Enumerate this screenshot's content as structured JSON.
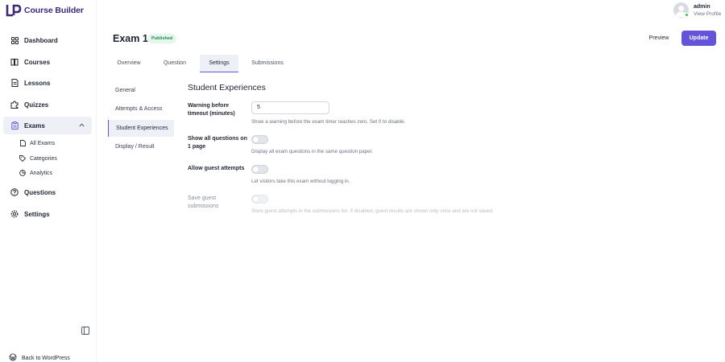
{
  "app": {
    "logo_text": "Course Builder"
  },
  "sidebar": {
    "items": [
      {
        "label": "Dashboard",
        "icon": "grid-icon"
      },
      {
        "label": "Courses",
        "icon": "book-icon"
      },
      {
        "label": "Lessons",
        "icon": "document-icon"
      },
      {
        "label": "Quizzes",
        "icon": "puzzle-icon"
      },
      {
        "label": "Exams",
        "icon": "clipboard-icon"
      },
      {
        "label": "Questions",
        "icon": "question-icon"
      },
      {
        "label": "Settings",
        "icon": "gear-icon"
      }
    ],
    "exams_sub": [
      {
        "label": "All Exams",
        "icon": "file-icon"
      },
      {
        "label": "Categories",
        "icon": "tags-icon"
      },
      {
        "label": "Analytics",
        "icon": "pie-icon"
      }
    ],
    "back_label": "Back to WordPress"
  },
  "profile": {
    "name": "admin",
    "link": "View Profile"
  },
  "header": {
    "title": "Exam 1",
    "status": "Published",
    "preview_label": "Preview",
    "update_label": "Update"
  },
  "tabs": [
    "Overview",
    "Question",
    "Settings",
    "Submissions"
  ],
  "settings_nav": [
    "General",
    "Attempts & Access",
    "Student Experiences",
    "Display / Result"
  ],
  "section": {
    "title": "Student Experiences",
    "warning_label": "Warning before timeout (minutes)",
    "warning_value": "5",
    "warning_help": "Show a warning before the exam timer reaches zero. Set 0 to disable.",
    "show_all_label": "Show all questions on 1 page",
    "show_all_help": "Display all exam questions in the same question paper.",
    "guest_label": "Allow guest attempts",
    "guest_help": "Let visitors take this exam without logging in.",
    "save_guest_label": "Save guest submissions",
    "save_guest_help": "Store guest attempts in the submissions list. If disabled, guest results are shown only once and are not saved."
  },
  "colors": {
    "accent": "#6454d9",
    "badge_bg": "#e6f6ec",
    "badge_text": "#228a4b",
    "active_bg": "#eef0f8"
  }
}
